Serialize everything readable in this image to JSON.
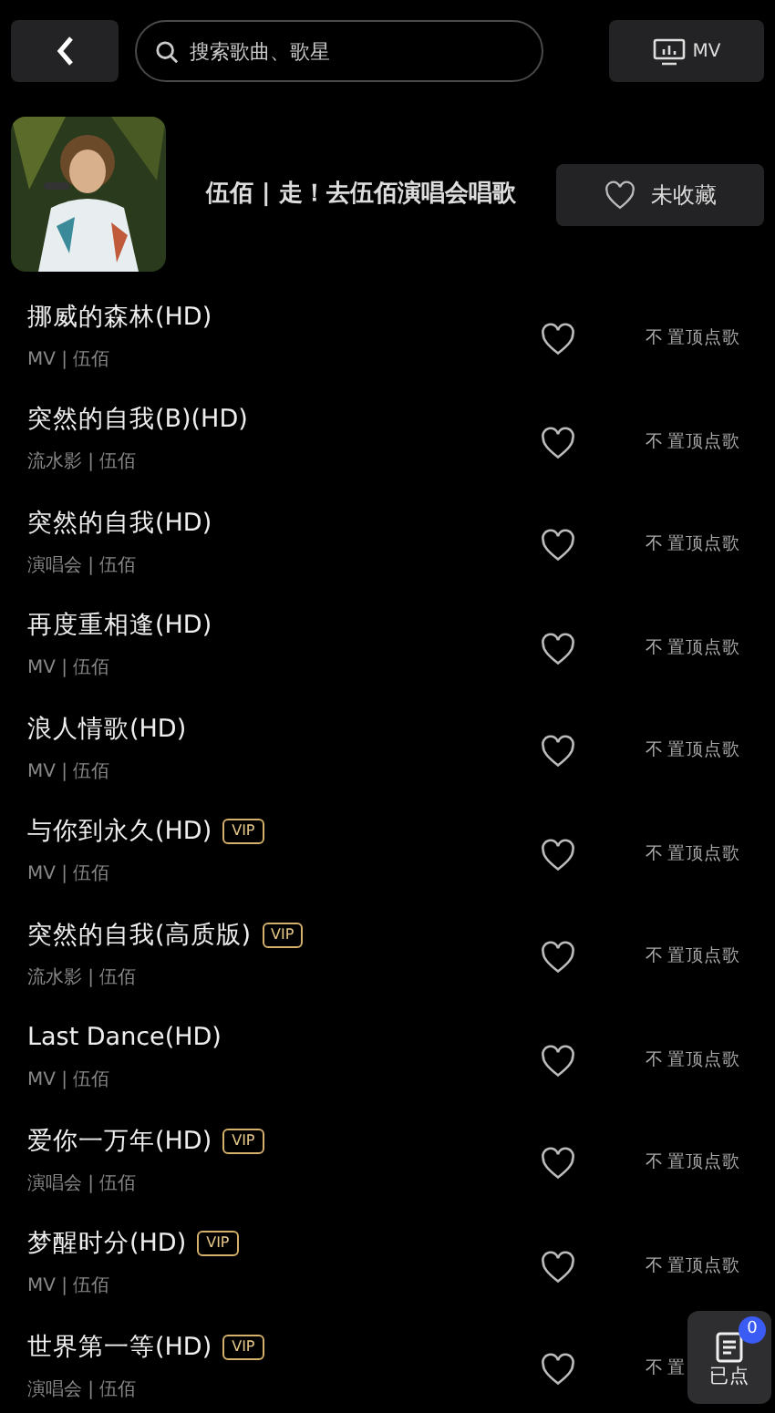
{
  "header": {
    "search": {
      "placeholder": "搜索歌曲、歌星"
    },
    "mv_button": "MV"
  },
  "artist": {
    "title": "伍佰 | 走！去伍佰演唱会唱歌",
    "favorite_button": {
      "label": "未收藏",
      "selected": false
    }
  },
  "songs": [
    {
      "title": "挪威的森林(HD)",
      "vip": false,
      "subtitle": "MV | 伍佰",
      "favorited": false,
      "pin_mark": "不",
      "action": "置顶点歌"
    },
    {
      "title": "突然的自我(B)(HD)",
      "vip": false,
      "subtitle": "流水影 | 伍佰",
      "favorited": false,
      "pin_mark": "不",
      "action": "置顶点歌"
    },
    {
      "title": "突然的自我(HD)",
      "vip": false,
      "subtitle": "演唱会 | 伍佰",
      "favorited": false,
      "pin_mark": "不",
      "action": "置顶点歌"
    },
    {
      "title": "再度重相逢(HD)",
      "vip": false,
      "subtitle": "MV | 伍佰",
      "favorited": false,
      "pin_mark": "不",
      "action": "置顶点歌"
    },
    {
      "title": "浪人情歌(HD)",
      "vip": false,
      "subtitle": "MV | 伍佰",
      "favorited": false,
      "pin_mark": "不",
      "action": "置顶点歌"
    },
    {
      "title": "与你到永久(HD)",
      "vip": true,
      "vip_label": "VIP",
      "subtitle": "MV | 伍佰",
      "favorited": false,
      "pin_mark": "不",
      "action": "置顶点歌"
    },
    {
      "title": "突然的自我(高质版)",
      "vip": true,
      "vip_label": "VIP",
      "subtitle": "流水影 | 伍佰",
      "favorited": false,
      "pin_mark": "不",
      "action": "置顶点歌"
    },
    {
      "title": "Last Dance(HD)",
      "vip": false,
      "subtitle": "MV | 伍佰",
      "favorited": false,
      "pin_mark": "不",
      "action": "置顶点歌"
    },
    {
      "title": "爱你一万年(HD)",
      "vip": true,
      "vip_label": "VIP",
      "subtitle": "演唱会 | 伍佰",
      "favorited": false,
      "pin_mark": "不",
      "action": "置顶点歌"
    },
    {
      "title": "梦醒时分(HD)",
      "vip": true,
      "vip_label": "VIP",
      "subtitle": "MV | 伍佰",
      "favorited": false,
      "pin_mark": "不",
      "action": "置顶点歌"
    },
    {
      "title": "世界第一等(HD)",
      "vip": true,
      "vip_label": "VIP",
      "subtitle": "演唱会 | 伍佰",
      "favorited": false,
      "pin_mark": "不",
      "action": "置"
    }
  ],
  "queue_button": {
    "label": "已点",
    "count": "0"
  }
}
